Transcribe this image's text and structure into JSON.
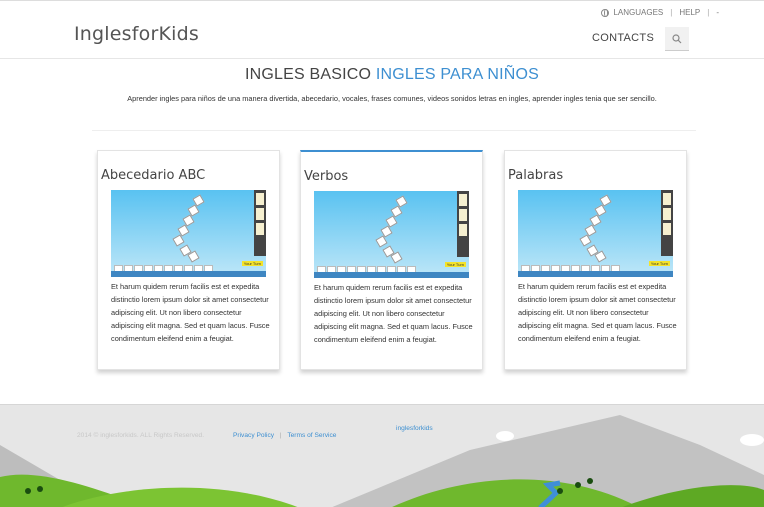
{
  "header": {
    "logo": "InglesforKids",
    "util": {
      "languages": "LANGUAGES",
      "separator": "|",
      "help": "HELP",
      "separator2": "|",
      "trailing": "-"
    },
    "contacts": "CONTACTS",
    "icons": {
      "globe": "globe-icon",
      "search": "search-icon"
    }
  },
  "intro": {
    "title_main": "INGLES BASICO",
    "title_accent": "INGLES PARA NIÑOS",
    "subtitle": "Aprender ingles para niños de una manera divertida, abecedario, vocales, frases comunes, videos sonidos letras en ingles, aprender ingles tenia que ser sencillo."
  },
  "cards": [
    {
      "title": "Abecedario ABC",
      "text": "Et harum quidem rerum facilis est et expedita distinctio lorem ipsum dolor sit amet consectetur adipiscing elit. Ut non libero consectetur adipiscing elit magna. Sed et quam lacus. Fusce condimentum eleifend enim a feugiat."
    },
    {
      "title": "Verbos",
      "text": "Et harum quidem rerum facilis est et expedita distinctio lorem ipsum dolor sit amet consectetur adipiscing elit. Ut non libero consectetur adipiscing elit magna. Sed et quam lacus. Fusce condimentum eleifend enim a feugiat."
    },
    {
      "title": "Palabras",
      "text": "Et harum quidem rerum facilis est et expedita distinctio lorem ipsum dolor sit amet consectetur adipiscing elit. Ut non libero consectetur adipiscing elit magna. Sed et quam lacus. Fusce condimentum eleifend enim a feugiat."
    }
  ],
  "footer": {
    "copyright": "2014 © inglesforkids. ALL Rights Reserved.",
    "privacy": "Privacy Policy",
    "separator": "|",
    "terms": "Terms of Service",
    "brand": "inglesforkids"
  },
  "colors": {
    "accent": "#3d8fd1",
    "text": "#333333",
    "footer_bg": "#e6e6e6"
  }
}
